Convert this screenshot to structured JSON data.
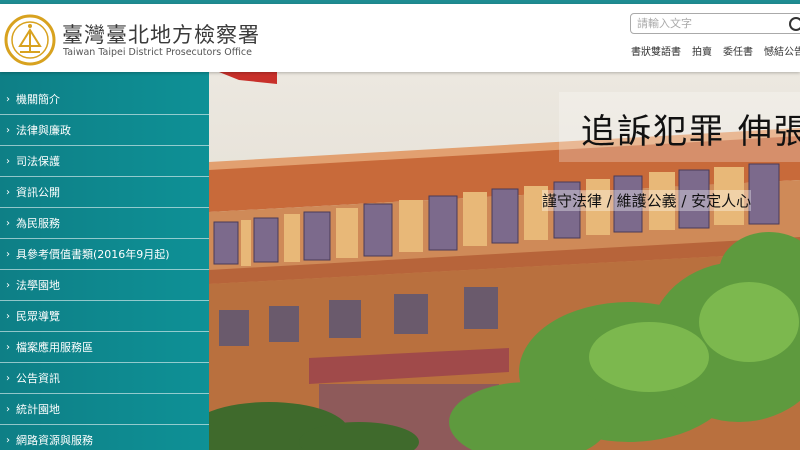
{
  "header": {
    "org_name_zh": "臺灣臺北地方檢察署",
    "org_name_en": "Taiwan Taipei District Prosecutors Office",
    "search_placeholder": "請輸入文字",
    "links": [
      "書狀雙語書",
      "拍賣",
      "委任書",
      "憾結公告"
    ]
  },
  "sidebar": {
    "items": [
      {
        "label": "機關簡介"
      },
      {
        "label": "法律與廉政"
      },
      {
        "label": "司法保護"
      },
      {
        "label": "資訊公開"
      },
      {
        "label": "為民服務"
      },
      {
        "label": "具參考價值書類(2016年9月起)"
      },
      {
        "label": "法學園地"
      },
      {
        "label": "民眾導覽"
      },
      {
        "label": "檔案應用服務區"
      },
      {
        "label": "公告資訊"
      },
      {
        "label": "統計園地"
      },
      {
        "label": "網路資源與服務"
      }
    ]
  },
  "banner": {
    "slogan_main": "追訴犯罪 伸張",
    "slogan_sub": "謹守法律 / 維護公義 / 安定人心"
  },
  "colors": {
    "accent": "#1f8c92",
    "sidebar": "#0e878d"
  }
}
